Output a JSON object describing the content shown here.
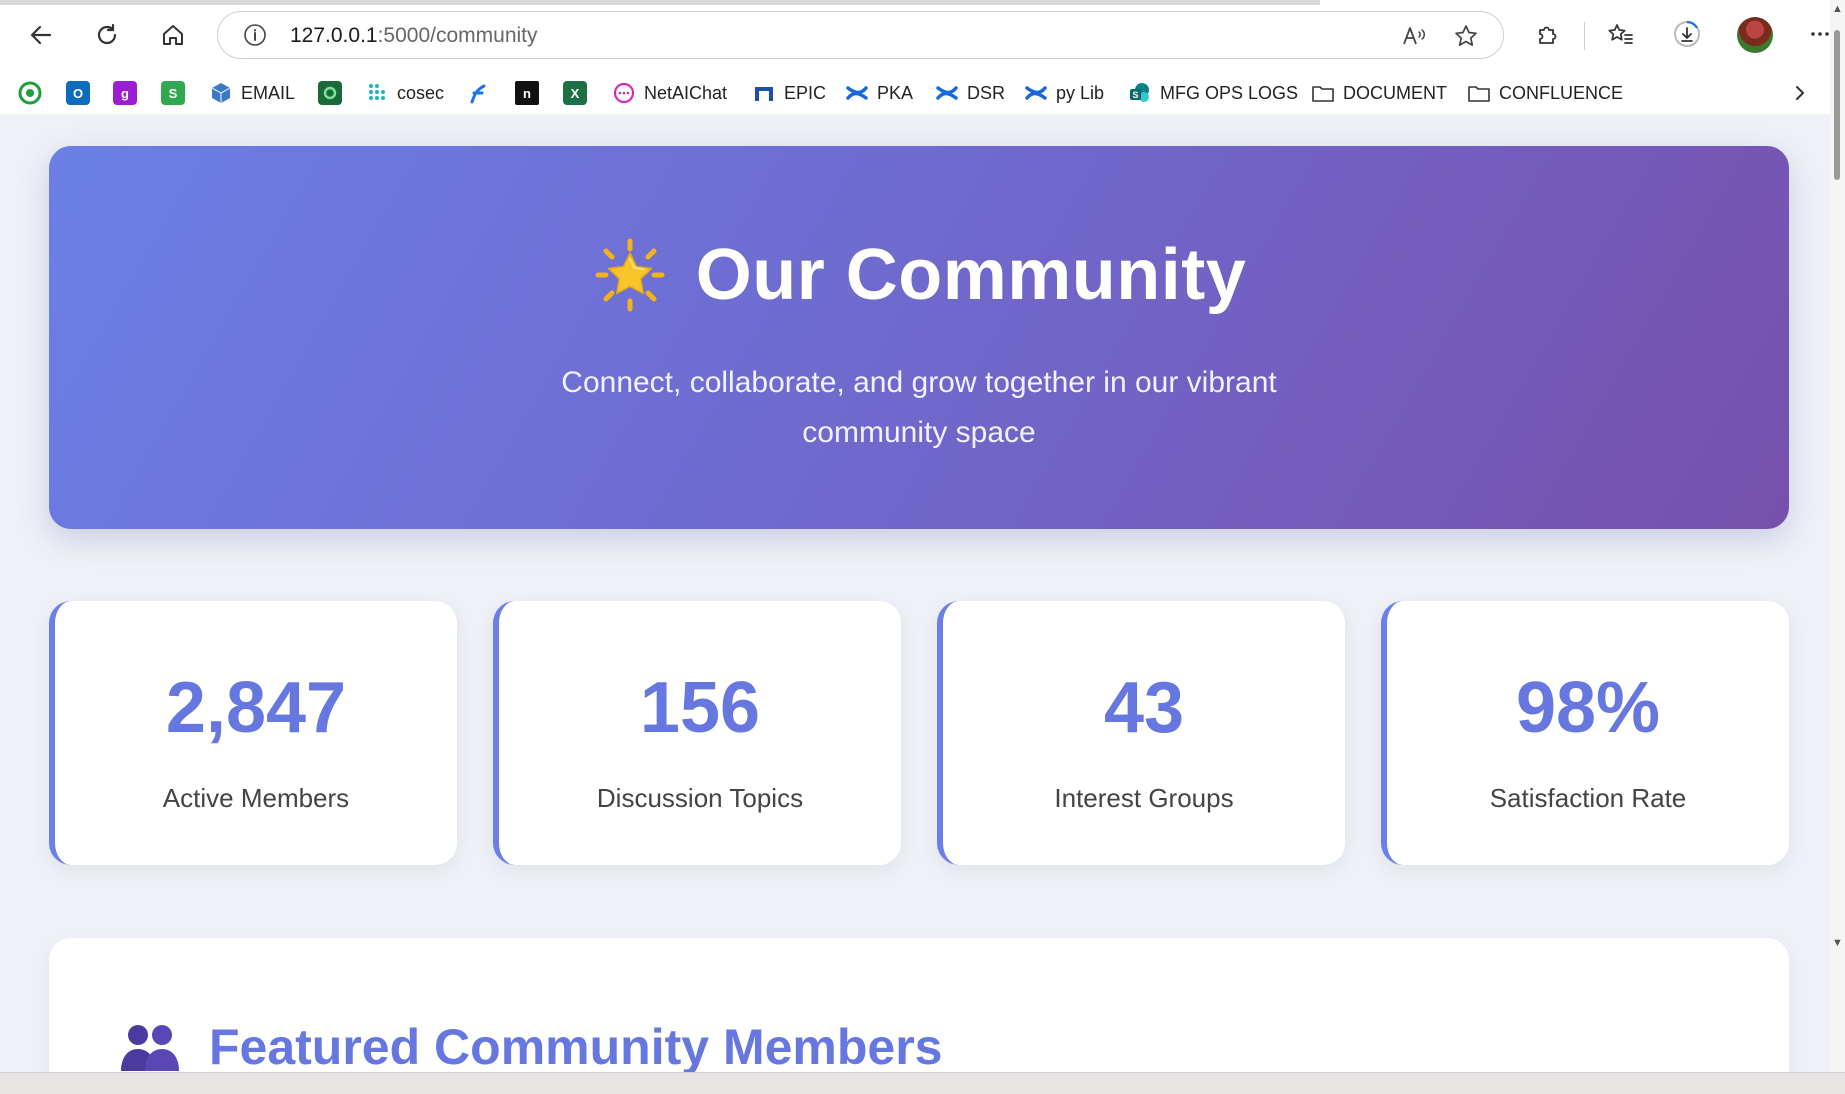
{
  "browser": {
    "url_host": "127.0.0.1",
    "url_path": ":5000/community",
    "bookmarks": [
      {
        "label": "",
        "icon": "green-circle-icon",
        "color": "#1e9e3e"
      },
      {
        "label": "",
        "icon": "outlook-icon",
        "color": "#0f6cbd"
      },
      {
        "label": "",
        "icon": "g-icon",
        "color": "#9b1fd0"
      },
      {
        "label": "",
        "icon": "sheets-icon",
        "color": "#2fa84f"
      },
      {
        "label": "EMAIL",
        "icon": "cube-icon",
        "color": "#3a78c9"
      },
      {
        "label": "",
        "icon": "square-o-icon",
        "color": "#1b6b3a"
      },
      {
        "label": "cosec",
        "icon": "dots-icon",
        "color": "#1ab3c9"
      },
      {
        "label": "",
        "icon": "f-icon",
        "color": "#1a73e8"
      },
      {
        "label": "",
        "icon": "n-icon",
        "color": "#111111"
      },
      {
        "label": "",
        "icon": "excel-icon",
        "color": "#1d7044"
      },
      {
        "label": "NetAIChat",
        "icon": "chat-icon",
        "color": "#d52bb0"
      },
      {
        "label": "EPIC",
        "icon": "epic-icon",
        "color": "#1f4fa8"
      },
      {
        "label": "PKA",
        "icon": "confluence-icon",
        "color": "#1868db"
      },
      {
        "label": "DSR",
        "icon": "confluence-icon",
        "color": "#1868db"
      },
      {
        "label": "py Lib",
        "icon": "confluence-icon",
        "color": "#1868db"
      },
      {
        "label": "MFG OPS LOGS",
        "icon": "sharepoint-icon",
        "color": "#038387"
      },
      {
        "label": "DOCUMENT",
        "icon": "folder-icon",
        "color": "#333333"
      },
      {
        "label": "CONFLUENCE",
        "icon": "folder-icon",
        "color": "#333333"
      }
    ]
  },
  "hero": {
    "title": "Our Community",
    "subtitle": "Connect, collaborate, and grow together in our vibrant community space",
    "icon": "star-icon"
  },
  "stats": [
    {
      "value": "2,847",
      "label": "Active Members"
    },
    {
      "value": "156",
      "label": "Discussion Topics"
    },
    {
      "value": "43",
      "label": "Interest Groups"
    },
    {
      "value": "98%",
      "label": "Satisfaction Rate"
    }
  ],
  "featured": {
    "title": "Featured Community Members",
    "icon": "people-icon"
  },
  "colors": {
    "accent": "#6677e0",
    "hero_start": "#6b7fe6",
    "hero_end": "#7750ad"
  }
}
